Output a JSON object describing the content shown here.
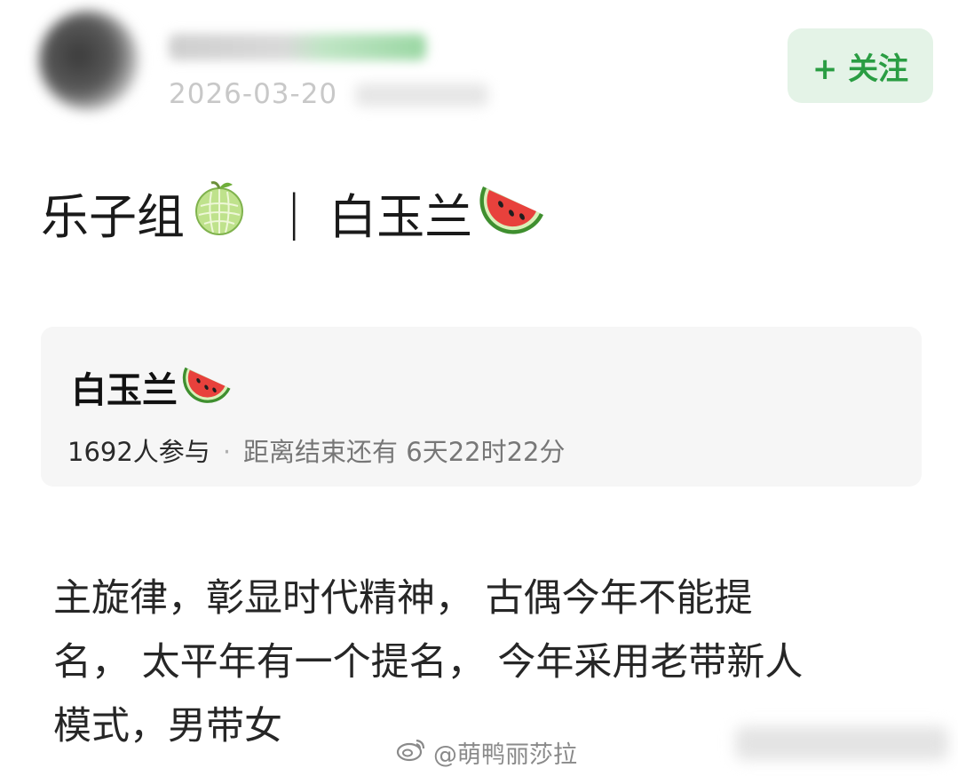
{
  "header": {
    "username": "",
    "date": "2026-03-20",
    "follow_label": "+ 关注"
  },
  "post": {
    "title_left": "乐子组",
    "title_left_icon": "melon-icon",
    "title_separator": "|",
    "title_right": "白玉兰",
    "title_right_icon": "watermelon-icon"
  },
  "vote": {
    "title": "白玉兰",
    "title_icon": "watermelon-icon",
    "participants": "1692人参与",
    "separator": "·",
    "remaining": "距离结束还有 6天22时22分"
  },
  "body": {
    "lines": [
      "主旋律，彰显时代精神， 古偶今年不能提",
      "名， 太平年有一个提名， 今年采用老带新人",
      "模式，男带女"
    ]
  },
  "watermark": {
    "icon": "weibo-icon",
    "text": "@萌鸭丽莎拉"
  },
  "colors": {
    "follow_bg": "#e4f3e7",
    "follow_text": "#2a9d43",
    "card_bg": "#f6f6f6"
  }
}
